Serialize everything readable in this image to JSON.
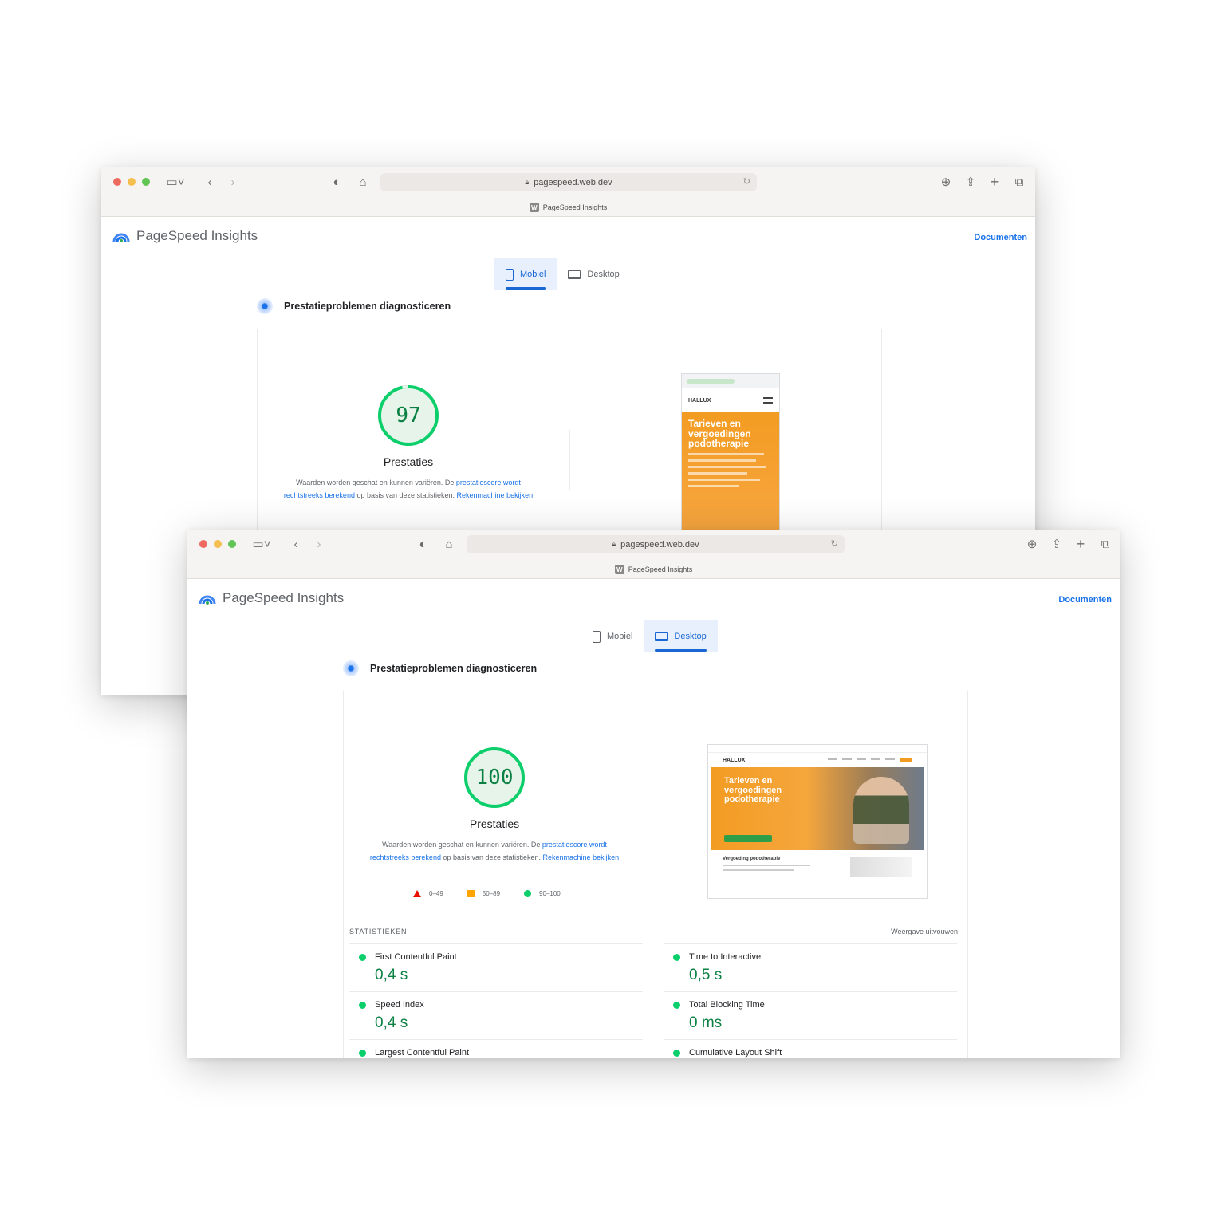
{
  "browser": {
    "url": "pagespeed.web.dev",
    "tab_title": "PageSpeed Insights",
    "favicon_letter": "W"
  },
  "psi": {
    "brand": "PageSpeed Insights",
    "docs_link": "Documenten",
    "tabs": {
      "mobile": "Mobiel",
      "desktop": "Desktop"
    },
    "diagnose_heading": "Prestatieproblemen diagnosticeren",
    "score_label": "Prestaties",
    "note": {
      "text1": "Waarden worden geschat en kunnen variëren. De ",
      "link1": "prestatiescore wordt rechtstreeks berekend",
      "text2": " op basis van deze statistieken. ",
      "link2": "Rekenmachine bekijken"
    },
    "legend": {
      "fail": "0–49",
      "average": "50–89",
      "pass": "90–100"
    },
    "stats_heading": "STATISTIEKEN",
    "expand_view": "Weergave uitvouwen"
  },
  "mobile_report": {
    "score": 97,
    "active_tab": "mobile"
  },
  "desktop_report": {
    "score": 100,
    "active_tab": "desktop",
    "metrics": [
      {
        "name": "First Contentful Paint",
        "value": "0,4 s",
        "status": "pass"
      },
      {
        "name": "Time to Interactive",
        "value": "0,5 s",
        "status": "pass"
      },
      {
        "name": "Speed Index",
        "value": "0,4 s",
        "status": "pass"
      },
      {
        "name": "Total Blocking Time",
        "value": "0 ms",
        "status": "pass"
      },
      {
        "name": "Largest Contentful Paint",
        "value": "",
        "status": "pass"
      },
      {
        "name": "Cumulative Layout Shift",
        "value": "",
        "status": "pass"
      }
    ]
  },
  "site_preview": {
    "logo_text": "HALLUX",
    "hero_title": "Tarieven en vergoedingen podotherapie",
    "sub_title": "Vergoeding podotherapie"
  },
  "colors": {
    "pass": "#0cce6b",
    "pass_text": "#0b8043",
    "average": "#ffa400",
    "fail": "#eb0f00",
    "link": "#1a73e8",
    "accent_orange": "#f39c23"
  }
}
